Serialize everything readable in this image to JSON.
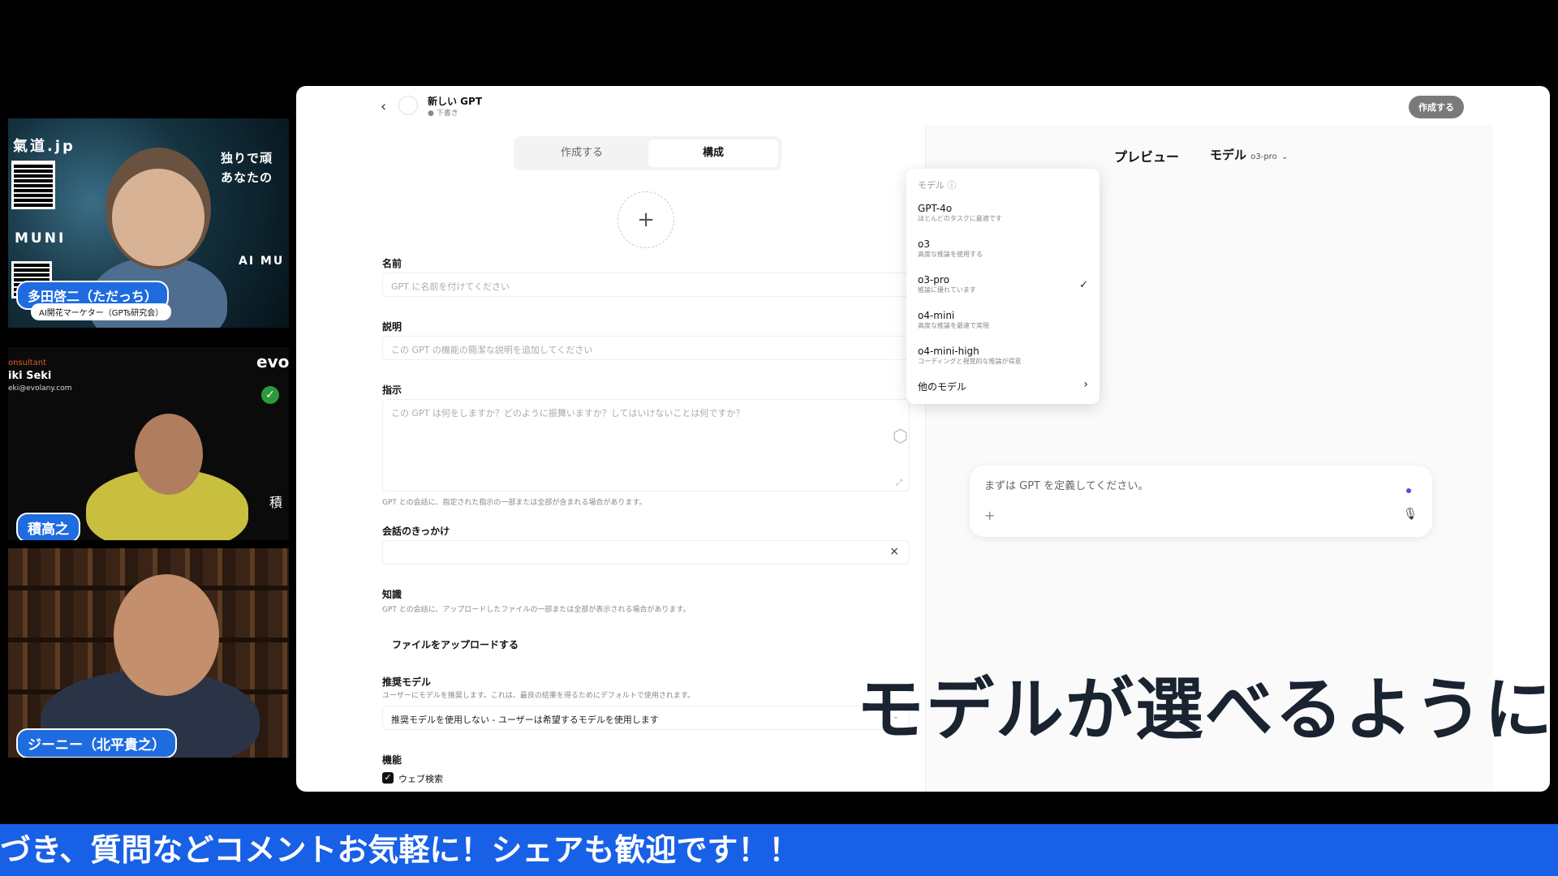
{
  "videos": {
    "tile1": {
      "overlay_top": "氣道.jp",
      "overlay_right_top": "独りで頑",
      "overlay_right_mid": "あなたの",
      "overlay_left_mid": "MUNI",
      "overlay_right_low": "AI MU",
      "name": "多田啓二（ただっち）",
      "title": "AI開花マーケター（GPTs研究会）"
    },
    "tile2": {
      "card_role": "onsultant",
      "card_name": "iki Seki",
      "card_email": "eki@evolany.com",
      "card_brand": "evo",
      "side_char": "積",
      "name": "積高之"
    },
    "tile3": {
      "name": "ジーニー（北平貴之）"
    }
  },
  "app": {
    "back_icon": "chevron-left-icon",
    "gpt_name": "新しい GPT",
    "gpt_status": "● 下書き",
    "create_button": "作成する",
    "tabs": [
      "作成する",
      "構成"
    ],
    "form": {
      "name_label": "名前",
      "name_placeholder": "GPT に名前を付けてください",
      "desc_label": "説明",
      "desc_placeholder": "この GPT の機能の簡潔な説明を追加してください",
      "instr_label": "指示",
      "instr_placeholder": "この GPT は何をしますか？どのように振舞いますか？してはいけないことは何ですか？",
      "instr_hint": "GPT との会話に、指定された指示の一部または全部が含まれる場合があります。",
      "starters_label": "会話のきっかけ",
      "knowledge_label": "知識",
      "knowledge_hint": "GPT との会話に、アップロードしたファイルの一部または全部が表示される場合があります。",
      "upload_button": "ファイルをアップロードする",
      "rec_model_label": "推奨モデル",
      "rec_model_hint": "ユーザーにモデルを推奨します。これは、最良の結果を得るためにデフォルトで使用されます。",
      "rec_model_value": "推奨モデルを使用しない - ユーザーは希望するモデルを使用します",
      "capabilities_label": "機能",
      "web_search_label": "ウェブ検索"
    },
    "preview": {
      "title": "プレビュー",
      "model_label": "モデル",
      "model_current": "o3-pro",
      "composer_placeholder": "まずは GPT を定義してください。"
    },
    "model_menu": {
      "header": "モデル ⓘ",
      "items": [
        {
          "name": "GPT-4o",
          "desc": "ほとんどのタスクに最適です"
        },
        {
          "name": "o3",
          "desc": "高度な推論を使用する"
        },
        {
          "name": "o3-pro",
          "desc": "推論に優れています",
          "selected": true
        },
        {
          "name": "o4-mini",
          "desc": "高度な推論を最速で実現"
        },
        {
          "name": "o4-mini-high",
          "desc": "コーディングと視覚的な推論が得意"
        }
      ],
      "more": "他のモデル"
    }
  },
  "caption": "モデルが選べるように",
  "ticker": "づき、質問などコメントお気軽に！シェアも歓迎です！！",
  "colors": {
    "ticker_bg": "#1860e6",
    "name_tag_bg": "#1f6be0",
    "caption_text": "#1a2330"
  }
}
